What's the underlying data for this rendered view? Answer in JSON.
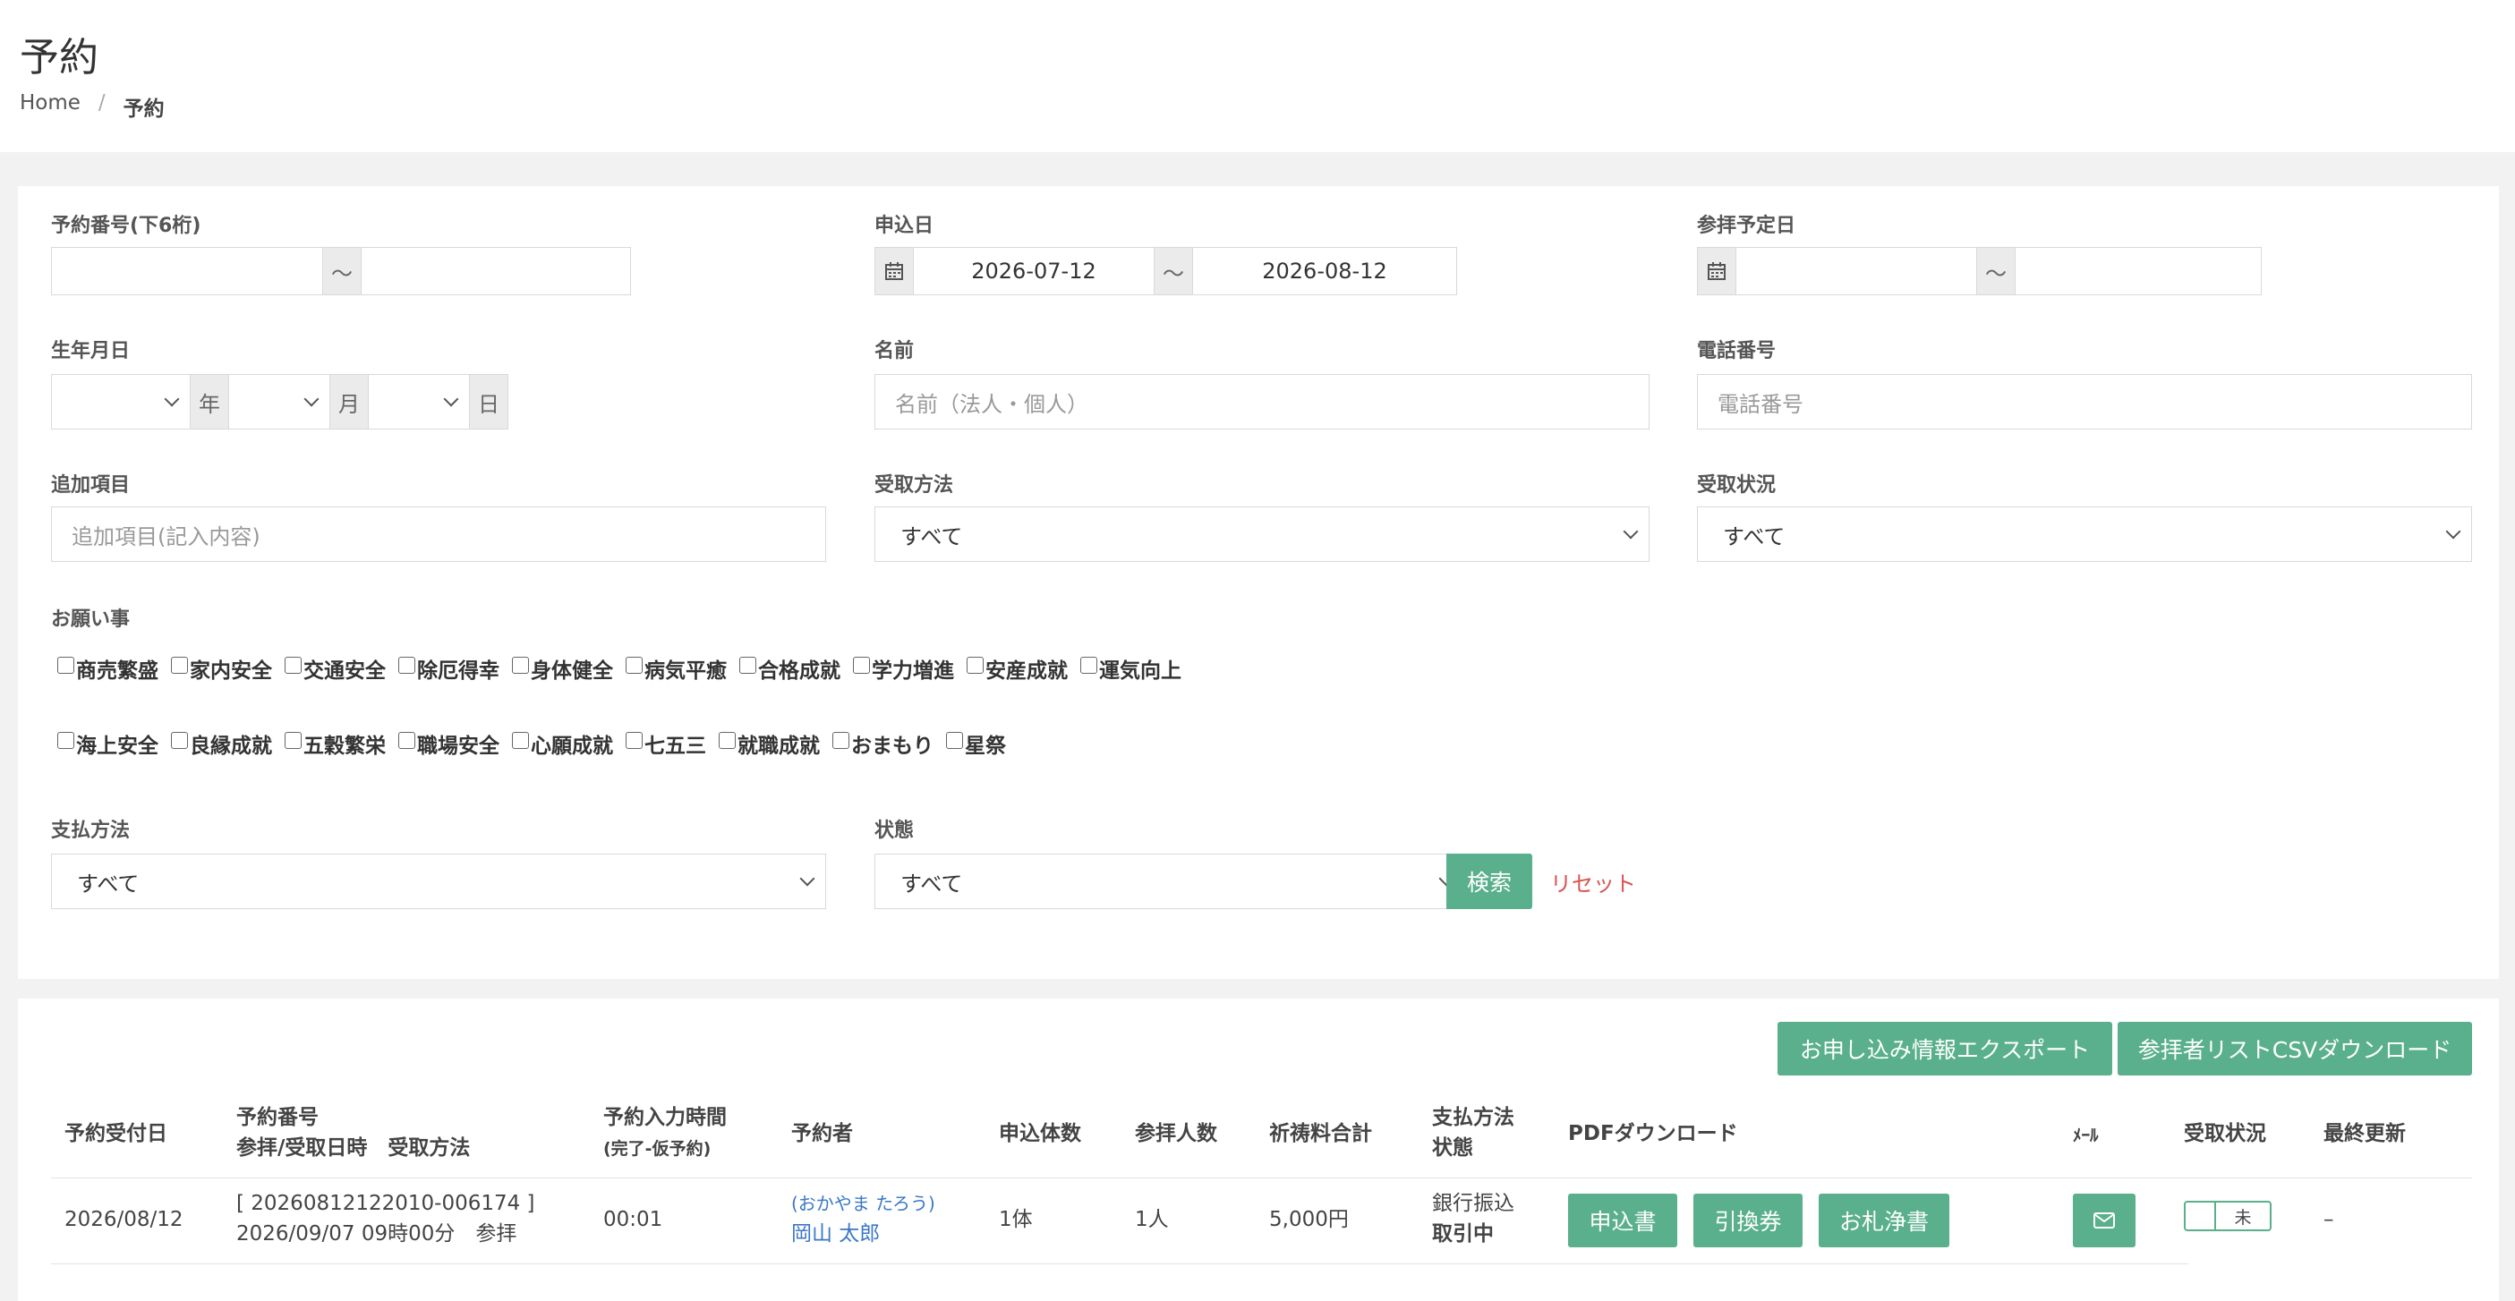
{
  "header": {
    "title": "予約",
    "breadcrumb": [
      "Home",
      "/",
      "予約"
    ]
  },
  "filters": {
    "reservation_no": {
      "label": "予約番号(下6桁)",
      "tilde": "〜"
    },
    "apply_date": {
      "label": "申込日",
      "from": "2026-07-12",
      "to": "2026-08-12",
      "tilde": "〜"
    },
    "visit_date": {
      "label": "参拝予定日",
      "tilde": "〜"
    },
    "birth": {
      "label": "生年月日",
      "year_unit": "年",
      "month_unit": "月",
      "day_unit": "日"
    },
    "name": {
      "label": "名前",
      "placeholder": "名前（法人・個人）"
    },
    "phone": {
      "label": "電話番号",
      "placeholder": "電話番号"
    },
    "extra": {
      "label": "追加項目",
      "placeholder": "追加項目(記入内容)"
    },
    "receive_method": {
      "label": "受取方法",
      "value": "すべて"
    },
    "receive_status": {
      "label": "受取状況",
      "value": "すべて"
    },
    "wishes": {
      "label": "お願い事",
      "row1": [
        "商売繁盛",
        "家内安全",
        "交通安全",
        "除厄得幸",
        "身体健全",
        "病気平癒",
        "合格成就",
        "学力増進",
        "安産成就",
        "運気向上"
      ],
      "row2": [
        "海上安全",
        "良縁成就",
        "五穀繁栄",
        "職場安全",
        "心願成就",
        "七五三",
        "就職成就",
        "おまもり",
        "星祭"
      ]
    },
    "payment": {
      "label": "支払方法",
      "value": "すべて"
    },
    "status": {
      "label": "状態",
      "value": "すべて"
    },
    "search_label": "検索",
    "reset_label": "リセット"
  },
  "actions": {
    "export_label": "お申し込み情報エクスポート",
    "csv_label": "参拝者リストCSVダウンロード"
  },
  "table": {
    "headers": {
      "received": "予約受付日",
      "number": "予約番号",
      "number_sub": "参拝/受取日時　受取方法",
      "input_time": "予約入力時間",
      "input_time_sub": "(完了-仮予約)",
      "reserver": "予約者",
      "count": "申込体数",
      "people": "参拝人数",
      "fee": "祈祷料合計",
      "pay": "支払方法",
      "pay_sub": "状態",
      "pdf": "PDFダウンロード",
      "mail": "ﾒｰﾙ",
      "recv": "受取状況",
      "updated": "最終更新"
    },
    "rows": [
      {
        "received": "2026/08/12",
        "number": "[ 20260812122010-006174 ]",
        "visit": "2026/09/07 09時00分　参拝",
        "input_time": "00:01",
        "kana": "(おかやま たろう)",
        "name": "岡山 太郎",
        "count": "1体",
        "people": "1人",
        "fee": "5,000円",
        "pay": "銀行振込",
        "status": "取引中",
        "pdf_buttons": [
          "申込書",
          "引換券",
          "お札浄書"
        ],
        "recv_toggle": "未",
        "updated": "–"
      }
    ]
  },
  "icons": [
    "calendar-icon",
    "envelope-icon",
    "chevron-down-icon"
  ],
  "colors": {
    "accent": "#5aaf8c",
    "reset": "#d9534f",
    "link": "#3a78c6"
  }
}
